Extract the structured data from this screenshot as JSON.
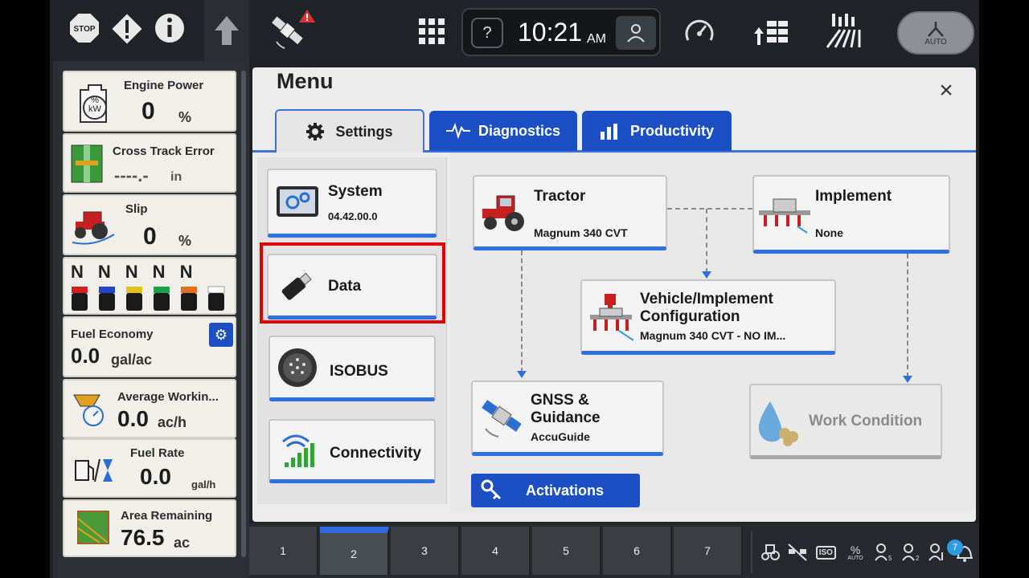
{
  "topbar": {
    "time": "10:21",
    "ampm": "AM",
    "help_glyph": "?",
    "auto_label": "AUTO",
    "stop_label": "STOP",
    "icons": [
      "stop-icon",
      "warning-icon",
      "info-icon",
      "up-arrow-icon",
      "gps-satellite-warning-icon",
      "apps-grid-icon",
      "help-icon",
      "user-icon",
      "speedometer-icon",
      "rows-icon",
      "field-icon",
      "auto-steer-icon"
    ]
  },
  "left_panel": {
    "engine_power": {
      "title": "Engine Power",
      "value": "0",
      "unit": "%",
      "icon_text": "% kW"
    },
    "cross_track": {
      "title": "Cross Track Error",
      "value": "----.-",
      "unit": "in"
    },
    "slip": {
      "title": "Slip",
      "value": "0",
      "unit": "%"
    },
    "gears": {
      "labels": [
        "N",
        "N",
        "N",
        "N",
        "N"
      ],
      "colors": [
        "#d01f1f",
        "#1f47c8",
        "#e0c21a",
        "#18a34a",
        "#e0701a",
        "#ffffff"
      ]
    },
    "fuel_economy": {
      "title": "Fuel Economy",
      "value": "0.0",
      "unit": "gal/ac"
    },
    "avg_working": {
      "title": "Average Workin...",
      "value": "0.0",
      "unit": "ac/h"
    },
    "fuel_rate": {
      "title": "Fuel Rate",
      "value": "0.0",
      "unit": "gal/h"
    },
    "area_remaining": {
      "title": "Area Remaining",
      "value": "76.5",
      "unit": "ac"
    }
  },
  "menu": {
    "title": "Menu",
    "close_glyph": "×",
    "tabs": [
      {
        "label": "Settings",
        "active": true
      },
      {
        "label": "Diagnostics",
        "active": false
      },
      {
        "label": "Productivity",
        "active": false
      }
    ],
    "categories": [
      {
        "label": "System",
        "sub": "04.42.00.0"
      },
      {
        "label": "Data",
        "sub": ""
      },
      {
        "label": "ISOBUS",
        "sub": ""
      },
      {
        "label": "Connectivity",
        "sub": ""
      }
    ],
    "cards": {
      "tractor": {
        "label": "Tractor",
        "sub": "Magnum 340 CVT"
      },
      "implement": {
        "label": "Implement",
        "sub": "None"
      },
      "vehicle_config": {
        "label1": "Vehicle/Implement",
        "label2": "Configuration",
        "sub": "Magnum 340 CVT - NO IM..."
      },
      "gnss": {
        "label1": "GNSS &",
        "label2": "Guidance",
        "sub": "AccuGuide"
      },
      "work_condition": {
        "label": "Work Condition"
      }
    },
    "activations_label": "Activations"
  },
  "bottombar": {
    "pages": [
      "1",
      "2",
      "3",
      "4",
      "5",
      "6",
      "7"
    ],
    "active_page": "2",
    "notification_count": "7",
    "status_icon_texts": [
      "ISO",
      "AUTO"
    ]
  },
  "colors": {
    "accent": "#1d4fc4",
    "highlight": "#e00000",
    "tab_border": "#3d73d9"
  }
}
